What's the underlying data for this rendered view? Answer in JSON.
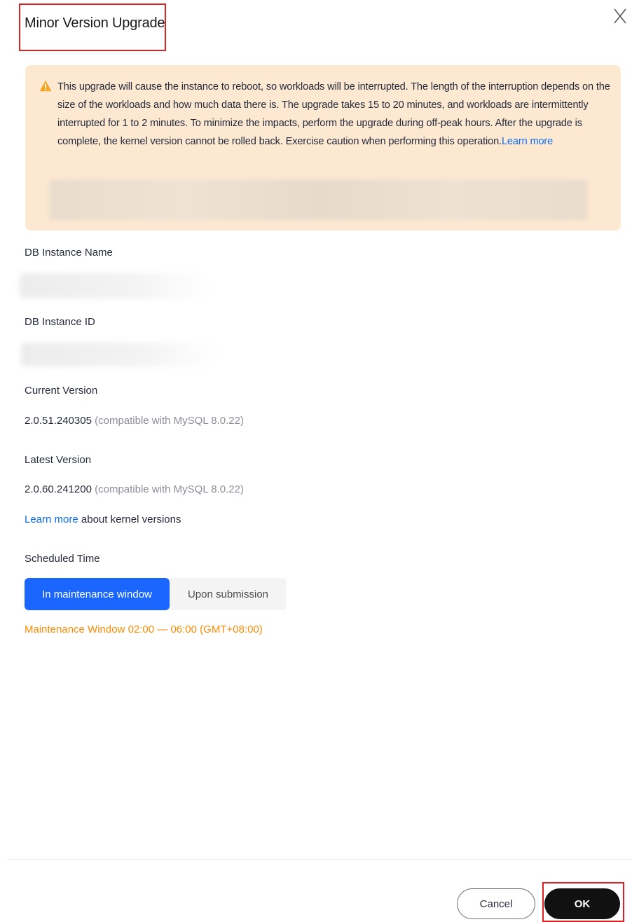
{
  "dialog": {
    "title": "Minor Version Upgrade",
    "close_icon": "close-icon"
  },
  "alert": {
    "icon": "warning-icon",
    "icon_color": "#f5a623",
    "text": "This upgrade will cause the instance to reboot, so workloads will be interrupted. The length of the interruption depends on the size of the workloads and how much data there is. The upgrade takes 15 to 20 minutes, and workloads are intermittently interrupted for 1 to 2 minutes. To minimize the impacts, perform the upgrade during off-peak hours. After the upgrade is complete, the kernel version cannot be rolled back. Exercise caution when performing this operation.",
    "link": "Learn more",
    "background": "#fde8d2"
  },
  "fields": {
    "instance_name_label": "DB Instance Name",
    "instance_id_label": "DB Instance ID",
    "current_version_label": "Current Version",
    "current_version_value": "2.0.51.240305",
    "current_version_compat": "(compatible with MySQL 8.0.22)",
    "latest_version_label": "Latest Version",
    "latest_version_value": "2.0.60.241200",
    "latest_version_compat": "(compatible with MySQL 8.0.22)",
    "kernel_link": "Learn more",
    "kernel_text": "about kernel versions"
  },
  "schedule": {
    "label": "Scheduled Time",
    "options": [
      "In maintenance window",
      "Upon submission"
    ],
    "selected": "In maintenance window",
    "maintenance_window": "Maintenance Window 02:00 — 06:00 (GMT+08:00)",
    "accent": "#1a66ff",
    "warning_color": "#ff8a00"
  },
  "footer": {
    "cancel": "Cancel",
    "ok": "OK"
  }
}
